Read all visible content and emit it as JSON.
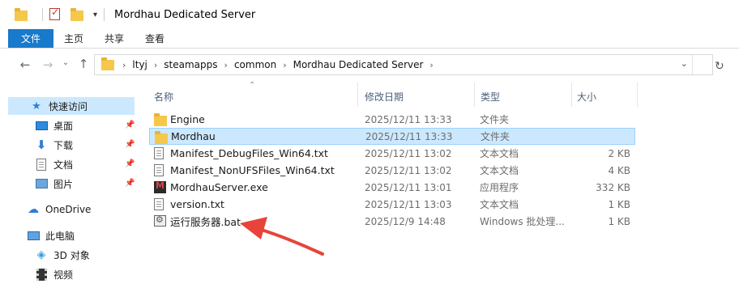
{
  "window": {
    "title": "Mordhau Dedicated Server"
  },
  "ribbon": {
    "tabs": [
      {
        "label": "文件"
      },
      {
        "label": "主页"
      },
      {
        "label": "共享"
      },
      {
        "label": "查看"
      }
    ]
  },
  "address": {
    "crumbs": [
      "ltyj",
      "steamapps",
      "common",
      "Mordhau Dedicated Server"
    ]
  },
  "sidebar": {
    "items": [
      {
        "label": "快速访问",
        "icon": "star-icon"
      },
      {
        "label": "桌面",
        "icon": "desktop-icon"
      },
      {
        "label": "下载",
        "icon": "download-icon"
      },
      {
        "label": "文档",
        "icon": "document-icon"
      },
      {
        "label": "图片",
        "icon": "picture-icon"
      },
      {
        "label": "OneDrive",
        "icon": "cloud-icon"
      },
      {
        "label": "此电脑",
        "icon": "computer-icon"
      },
      {
        "label": "3D 对象",
        "icon": "cube-icon"
      },
      {
        "label": "视频",
        "icon": "video-icon"
      }
    ]
  },
  "columns": {
    "name": "名称",
    "date": "修改日期",
    "type": "类型",
    "size": "大小"
  },
  "files": [
    {
      "name": "Engine",
      "date": "2025/12/11 13:33",
      "type": "文件夹",
      "size": "",
      "icon": "folder-icon"
    },
    {
      "name": "Mordhau",
      "date": "2025/12/11 13:33",
      "type": "文件夹",
      "size": "",
      "icon": "folder-icon"
    },
    {
      "name": "Manifest_DebugFiles_Win64.txt",
      "date": "2025/12/11 13:02",
      "type": "文本文档",
      "size": "2 KB",
      "icon": "text-file-icon"
    },
    {
      "name": "Manifest_NonUFSFiles_Win64.txt",
      "date": "2025/12/11 13:02",
      "type": "文本文档",
      "size": "4 KB",
      "icon": "text-file-icon"
    },
    {
      "name": "MordhauServer.exe",
      "date": "2025/12/11 13:01",
      "type": "应用程序",
      "size": "332 KB",
      "icon": "exe-icon"
    },
    {
      "name": "version.txt",
      "date": "2025/12/11 13:03",
      "type": "文本文档",
      "size": "1 KB",
      "icon": "text-file-icon"
    },
    {
      "name": "运行服务器.bat",
      "date": "2025/12/9 14:48",
      "type": "Windows 批处理...",
      "size": "1 KB",
      "icon": "batch-file-icon"
    }
  ],
  "colors": {
    "accent": "#1979ca",
    "selection": "#cce8ff",
    "annotation_arrow": "#e8443a"
  }
}
